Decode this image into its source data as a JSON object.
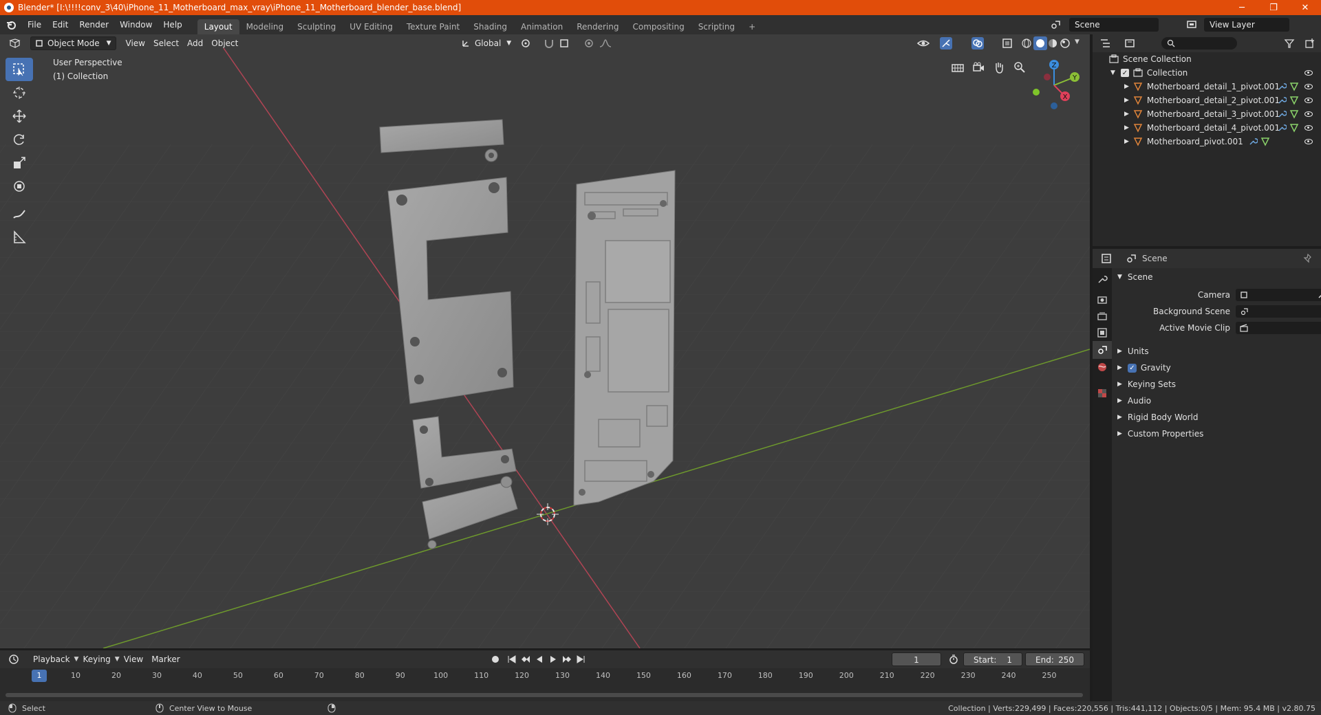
{
  "window": {
    "title": "Blender* [I:\\!!!!conv_3\\40\\iPhone_11_Motherboard_max_vray\\iPhone_11_Motherboard_blender_base.blend]",
    "minimize": "─",
    "maximize": "❐",
    "close": "✕"
  },
  "menu": [
    "File",
    "Edit",
    "Render",
    "Window",
    "Help"
  ],
  "workspaces": [
    "Layout",
    "Modeling",
    "Sculpting",
    "UV Editing",
    "Texture Paint",
    "Shading",
    "Animation",
    "Rendering",
    "Compositing",
    "Scripting"
  ],
  "workspace_add": "+",
  "scene": {
    "name": "Scene",
    "view_layer": "View Layer"
  },
  "viewport": {
    "mode": "Object Mode",
    "menus": [
      "View",
      "Select",
      "Add",
      "Object"
    ],
    "orientation": "Global",
    "perspective_label": "User Perspective",
    "collection_label": "(1) Collection",
    "gizmo_axes": {
      "x": "X",
      "y": "Y",
      "z": "Z"
    }
  },
  "outliner": {
    "root": "Scene Collection",
    "collection": "Collection",
    "objects": [
      "Motherboard_detail_1_pivot.001",
      "Motherboard_detail_2_pivot.001",
      "Motherboard_detail_3_pivot.001",
      "Motherboard_detail_4_pivot.001",
      "Motherboard_pivot.001"
    ]
  },
  "properties": {
    "header": "Scene",
    "section": "Scene",
    "fields": [
      {
        "label": "Camera"
      },
      {
        "label": "Background Scene"
      },
      {
        "label": "Active Movie Clip"
      }
    ],
    "panels": [
      "Units",
      "Gravity",
      "Keying Sets",
      "Audio",
      "Rigid Body World",
      "Custom Properties"
    ],
    "gravity_checked": true
  },
  "timeline": {
    "menus": [
      "Playback",
      "Keying",
      "View",
      "Marker"
    ],
    "current_frame": "1",
    "start_label": "Start:",
    "start": "1",
    "end_label": "End:",
    "end": "250",
    "ticks": [
      "1",
      "10",
      "20",
      "30",
      "40",
      "50",
      "60",
      "70",
      "80",
      "90",
      "100",
      "110",
      "120",
      "130",
      "140",
      "150",
      "160",
      "170",
      "180",
      "190",
      "200",
      "210",
      "220",
      "230",
      "240",
      "250"
    ]
  },
  "statusbar": {
    "select": "Select",
    "center_view": "Center View to Mouse",
    "stats": "Collection | Verts:229,499 | Faces:220,556 | Tris:441,112 | Objects:0/5 | Mem: 95.4 MB | v2.80.75"
  },
  "colors": {
    "titlebar": "#e14d0a",
    "accent": "#4772b3",
    "x_axis": "#e0405a",
    "y_axis": "#8bbf36",
    "z_axis": "#3b8ee0",
    "object_orange": "#e0843a"
  }
}
